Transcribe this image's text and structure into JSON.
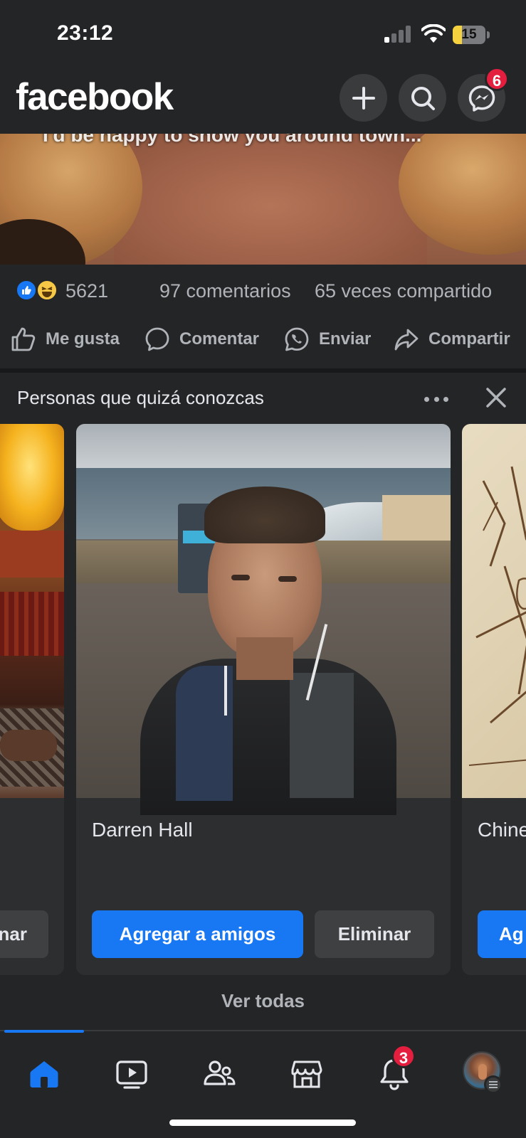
{
  "status_bar": {
    "time": "23:12",
    "battery": "15"
  },
  "header": {
    "logo": "facebook",
    "messenger_badge": "6",
    "icons": [
      "plus-icon",
      "search-icon",
      "messenger-icon"
    ]
  },
  "post": {
    "image_caption": "I'd be happy to show you around town...",
    "reactions_count": "5621",
    "comments": "97 comentarios",
    "shares": "65 veces compartido",
    "actions": {
      "like": "Me gusta",
      "comment": "Comentar",
      "send": "Enviar",
      "share": "Compartir"
    }
  },
  "pymk": {
    "title": "Personas que quizá conozcas",
    "left_card": {
      "secondary_label": "nar"
    },
    "main_card": {
      "name": "Darren Hall",
      "add_label": "Agregar a amigos",
      "remove_label": "Eliminar"
    },
    "right_card": {
      "name": "Chine",
      "add_label": "Ag"
    },
    "see_all": "Ver todas"
  },
  "bottom_nav": {
    "notifications_badge": "3",
    "items": [
      "home-icon",
      "video-icon",
      "friends-icon",
      "marketplace-icon",
      "notifications-icon",
      "profile-avatar"
    ]
  },
  "colors": {
    "background": "#242526",
    "accent": "#1877f2",
    "badge": "#e41e3f",
    "secondary_text": "#b0b3b8"
  }
}
